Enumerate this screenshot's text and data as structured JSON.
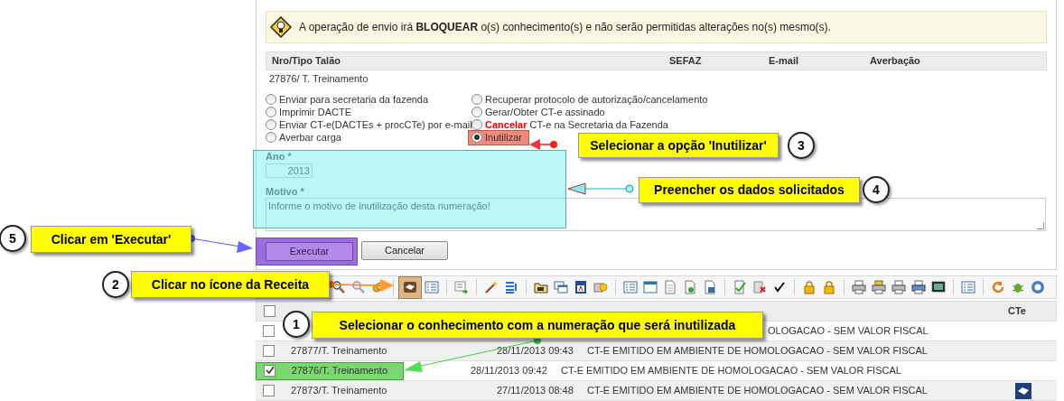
{
  "notice": {
    "text": "A operação de envio irá **BLOQUEAR** o(s) conhecimento(s) e não serão permitidas alterações no(s) mesmo(s)."
  },
  "summary_table": {
    "columns": [
      "Nro/Tipo Talão",
      "SEFAZ",
      "E-mail",
      "Averbação"
    ],
    "rows": [
      [
        "27876/ T. Treinamento"
      ]
    ]
  },
  "option_columns": [
    [
      {
        "label": "Enviar para secretaria da fazenda",
        "selected": false
      },
      {
        "label": "Imprimir DACTE",
        "selected": false
      },
      {
        "label": "Enviar CT-e(DACTEs + procCTe) por e-mail",
        "selected": false
      },
      {
        "label": "Averbar carga",
        "selected": false
      }
    ],
    [
      {
        "label": "Recuperar protocolo de autorização/cancelamento",
        "selected": false
      },
      {
        "label": "Gerar/Obter CT-e assinado",
        "selected": false
      },
      {
        "emphasis": "Cancelar",
        "label": "CT-e na Secretaria da Fazenda",
        "selected": false
      },
      {
        "label": "Inutilizar",
        "selected": true
      }
    ]
  ],
  "form": {
    "year_label": "Ano *",
    "year_value": "2013",
    "reason_label": "Motivo *",
    "reason_value": "Informe o motivo de inutilização desta numeração!"
  },
  "buttons": [
    "Executar",
    "Cancelar"
  ],
  "list": {
    "cte_header": "CTe",
    "header_checked": false,
    "rows": [
      {
        "checked": false,
        "client": "OLOGACAO - SEM VALOR FISCAL",
        "cte": false
      },
      {
        "checked": false,
        "number": "27877/T. Treinamento",
        "date": "28/11/2013 09:43",
        "client": "CT-E EMITIDO EM AMBIENTE DE HOMOLOGACAO - SEM VALOR FISCAL",
        "cte": false
      },
      {
        "checked": true,
        "number": "27876/T. Treinamento",
        "date": "28/11/2013 09:42",
        "client": "CT-E EMITIDO EM AMBIENTE DE HOMOLOGACAO - SEM VALOR FISCAL",
        "cte": false
      },
      {
        "checked": false,
        "number": "27873/T. Treinamento",
        "date": "27/11/2013 08:48",
        "client": "CT-E EMITIDO EM AMBIENTE DE HOMOLOGACAO - SEM VALOR FISCAL",
        "cte": true
      }
    ]
  },
  "annotations": [
    {
      "number": "3",
      "text": "Selecionar a opção 'Inutilizar'"
    },
    {
      "number": "4",
      "text": "Preencher os dados solicitados"
    },
    {
      "number": "5",
      "text": "Clicar em 'Executar'"
    },
    {
      "number": "2",
      "text": "Clicar no ícone da Receita"
    },
    {
      "number": "1",
      "text": "Selecionar o conhecimento com a numeração que será inutilizada"
    }
  ]
}
